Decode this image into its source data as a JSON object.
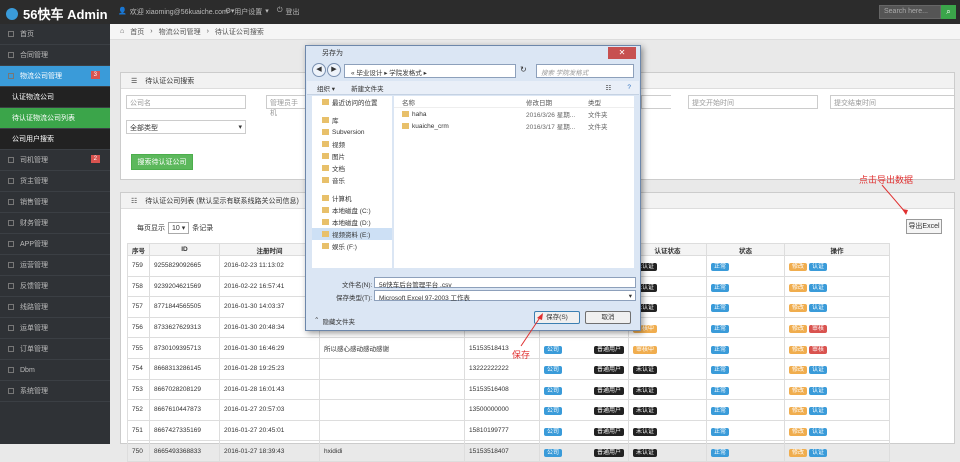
{
  "topbar": {
    "brand": "56快车 Admin",
    "user": "欢迎 xiaoming@56kuaiche.com",
    "settings": "用户设置",
    "logout": "登出",
    "search_placeholder": "Search here..."
  },
  "sidebar": {
    "items": [
      {
        "label": "首页"
      },
      {
        "label": "合同管理"
      },
      {
        "label": "物流公司管理",
        "badge": "3"
      },
      {
        "label": "认证物流公司"
      },
      {
        "label": "待认证物流公司列表"
      },
      {
        "label": "公司用户搜索"
      },
      {
        "label": "司机管理",
        "badge": "2"
      },
      {
        "label": "货主管理"
      },
      {
        "label": "销售管理"
      },
      {
        "label": "财务管理"
      },
      {
        "label": "APP管理"
      },
      {
        "label": "运营管理"
      },
      {
        "label": "反馈管理"
      },
      {
        "label": "线路管理"
      },
      {
        "label": "运单管理"
      },
      {
        "label": "订单管理"
      },
      {
        "label": "Dbm"
      },
      {
        "label": "系统管理"
      }
    ]
  },
  "breadcrumb": {
    "home": "首页",
    "level1": "物流公司管理",
    "level2": "待认证公司搜索"
  },
  "search_panel": {
    "title": "待认证公司搜索",
    "company_placeholder": "公司名",
    "manager_placeholder": "管理员手机",
    "start_placeholder": "提交开始时间",
    "end_placeholder": "提交结束时间",
    "type_value": "全部类型",
    "submit": "搜索待认证公司"
  },
  "list_panel": {
    "title": "待认证公司列表 (默认显示有联系线路关公司信息)",
    "per_page_prefix": "每页显示",
    "per_page": "10",
    "per_page_suffix": "条记录",
    "export": "导出Excel"
  },
  "table": {
    "headers": [
      "序号",
      "ID",
      "注册时间",
      "",
      "",
      "标签",
      "认证状态",
      "状态",
      "操作"
    ],
    "rows": [
      {
        "no": "759",
        "id": "9255829092665",
        "time": "2016-02-23 11:13:02",
        "name": "",
        "phone": "",
        "tag": "",
        "auth": "未认证",
        "auth_c": "black",
        "status": "正常",
        "ops": [
          "修改",
          "认证"
        ]
      },
      {
        "no": "758",
        "id": "9239204621569",
        "time": "2016-02-22 16:57:41",
        "name": "",
        "phone": "",
        "tag": "",
        "auth": "未认证",
        "auth_c": "black",
        "status": "正常",
        "ops": [
          "修改",
          "认证"
        ]
      },
      {
        "no": "757",
        "id": "8771844565505",
        "time": "2016-01-30 14:03:37",
        "name": "",
        "phone": "",
        "tag": "",
        "auth": "未认证",
        "auth_c": "black",
        "status": "正常",
        "ops": [
          "修改",
          "认证"
        ]
      },
      {
        "no": "756",
        "id": "8733627629313",
        "time": "2016-01-30 20:48:34",
        "name": "",
        "phone": "",
        "tag": "",
        "auth": "审核中",
        "auth_c": "org",
        "status": "正常",
        "ops": [
          "修改",
          "审核"
        ]
      },
      {
        "no": "755",
        "id": "8730109395713",
        "time": "2016-01-30 16:46:29",
        "name": "所以感心感动感动感谢",
        "phone": "15153518413",
        "tag": "公司",
        "tag2": "普通用户",
        "auth": "审核中",
        "auth_c": "org",
        "status": "正常",
        "ops": [
          "修改",
          "审核"
        ]
      },
      {
        "no": "754",
        "id": "8668313286145",
        "time": "2016-01-28 19:25:23",
        "name": "",
        "phone": "13222222222",
        "tag": "公司",
        "tag2": "普通用户",
        "auth": "未认证",
        "auth_c": "black",
        "status": "正常",
        "ops": [
          "修改",
          "认证"
        ]
      },
      {
        "no": "753",
        "id": "8667028208129",
        "time": "2016-01-28 16:01:43",
        "name": "",
        "phone": "15153516408",
        "tag": "公司",
        "tag2": "普通用户",
        "auth": "未认证",
        "auth_c": "black",
        "status": "正常",
        "ops": [
          "修改",
          "认证"
        ]
      },
      {
        "no": "752",
        "id": "8667610447873",
        "time": "2016-01-27 20:57:03",
        "name": "",
        "phone": "13500000000",
        "tag": "公司",
        "tag2": "普通用户",
        "auth": "未认证",
        "auth_c": "black",
        "status": "正常",
        "ops": [
          "修改",
          "认证"
        ]
      },
      {
        "no": "751",
        "id": "8667427335169",
        "time": "2016-01-27 20:45:01",
        "name": "",
        "phone": "15810199777",
        "tag": "公司",
        "tag2": "普通用户",
        "auth": "未认证",
        "auth_c": "black",
        "status": "正常",
        "ops": [
          "修改",
          "认证"
        ]
      },
      {
        "no": "750",
        "id": "8665493368833",
        "time": "2016-01-27 18:39:43",
        "name": "hxididi",
        "phone": "15153518407",
        "tag": "公司",
        "tag2": "普通用户",
        "auth": "未认证",
        "auth_c": "black",
        "status": "正常",
        "ops": [
          "修改",
          "认证"
        ]
      }
    ]
  },
  "dialog": {
    "title": "另存为",
    "path": "« 毕业设计 ▸ 学院发格式 ▸",
    "search_placeholder": "搜索 学院发格式",
    "organize": "组织 ▾",
    "new_folder": "新建文件夹",
    "tree": [
      "最近访问的位置",
      "库",
      "Subversion",
      "视频",
      "图片",
      "文档",
      "音乐",
      "计算机",
      "本地磁盘 (C:)",
      "本地磁盘 (D:)",
      "视频资料 (E:)",
      "娱乐 (F:)"
    ],
    "col_name": "名称",
    "col_date": "修改日期",
    "col_type": "类型",
    "files": [
      {
        "name": "haha",
        "date": "2016/3/26 星期...",
        "type": "文件夹"
      },
      {
        "name": "kuaiche_crm",
        "date": "2016/3/17 星期...",
        "type": "文件夹"
      }
    ],
    "filename_label": "文件名(N):",
    "filename": "56快车后台管理平台 .csv",
    "filetype_label": "保存类型(T):",
    "filetype": "Microsoft Excel 97-2003 工作表",
    "hide_folders": "隐藏文件夹",
    "save": "保存(S)",
    "cancel": "取消"
  },
  "annotations": {
    "export_hint": "点击导出数据",
    "save_hint": "保存"
  }
}
